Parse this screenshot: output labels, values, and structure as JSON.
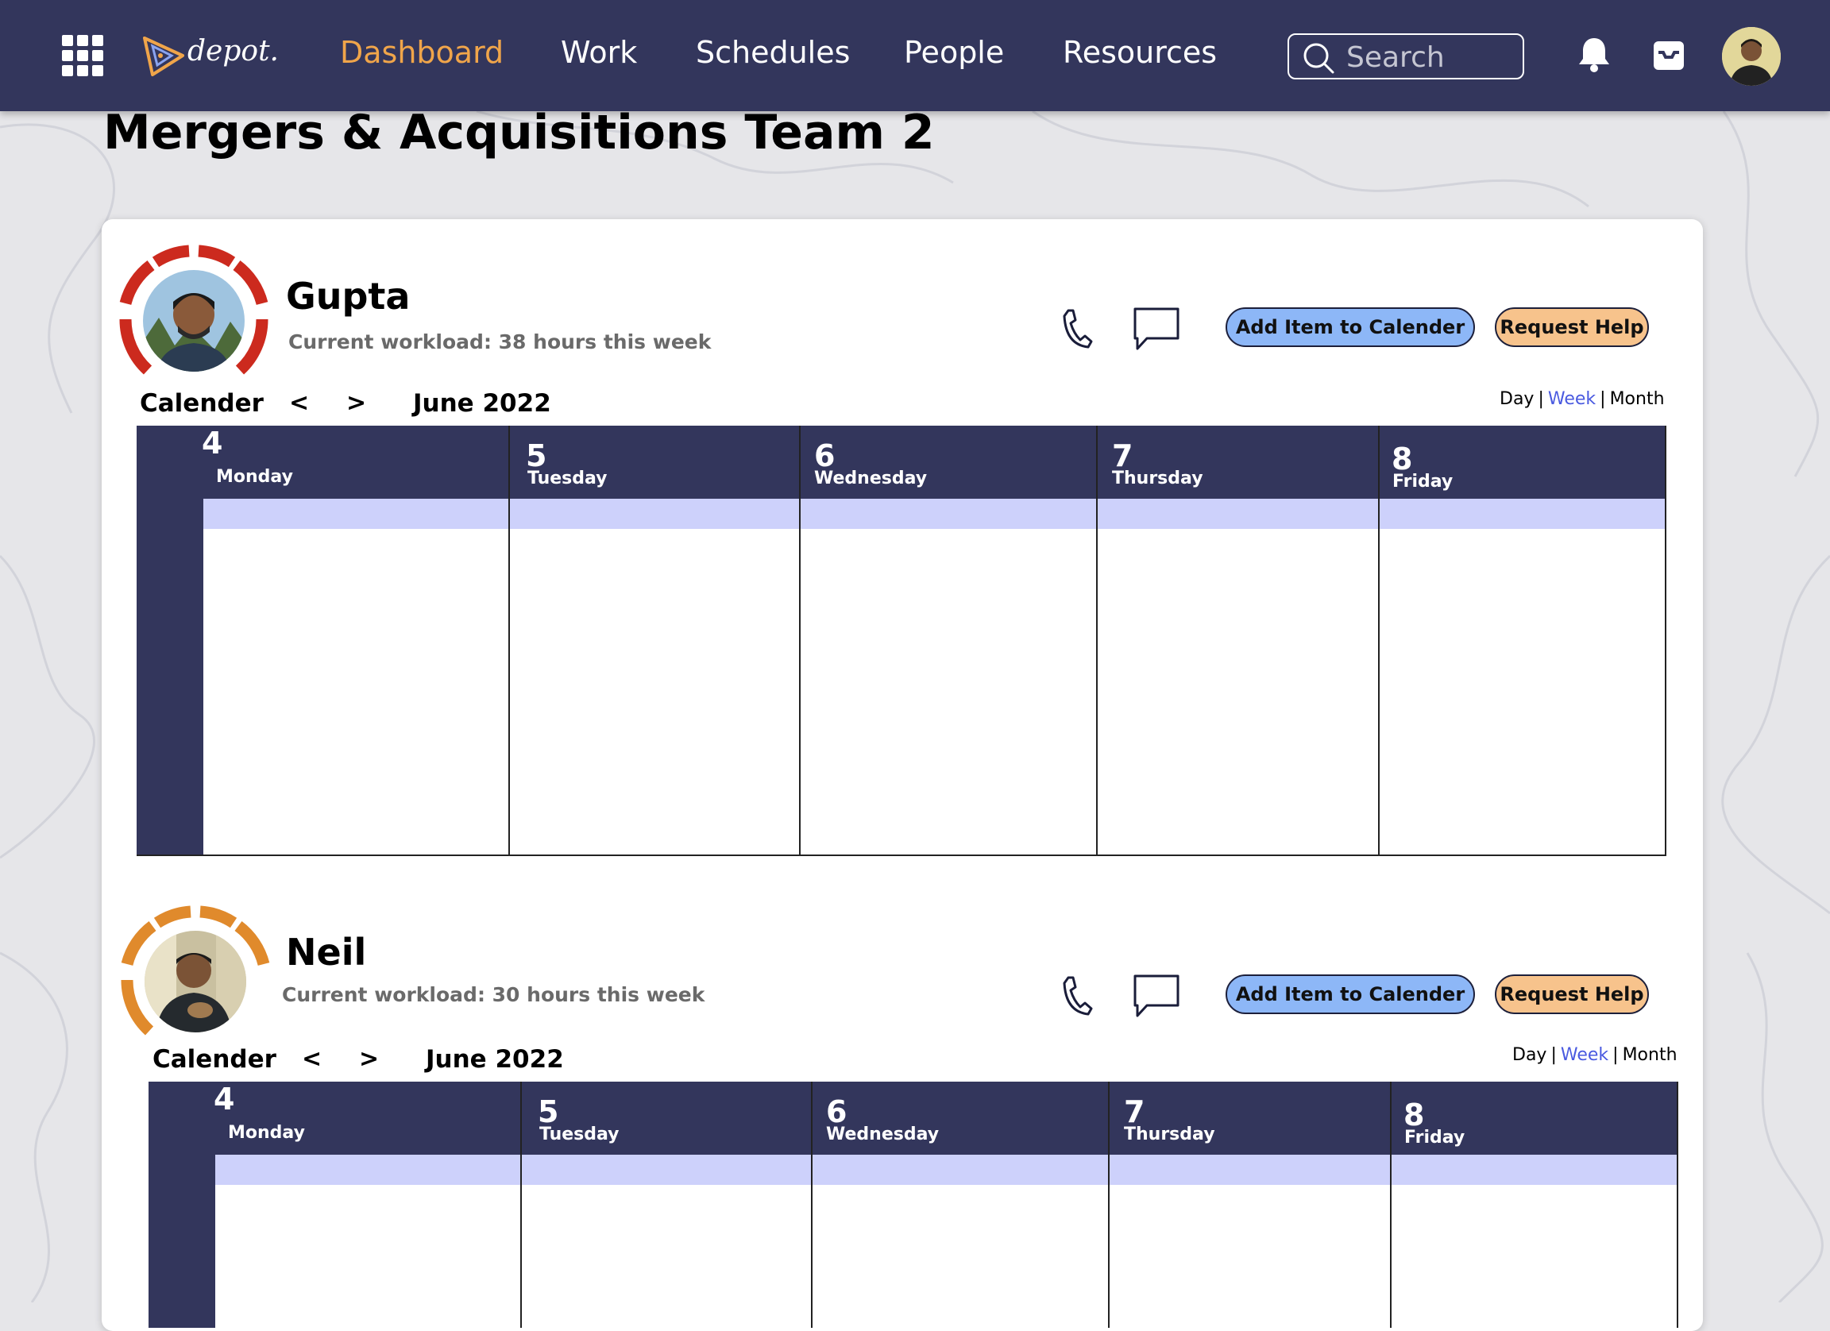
{
  "nav": {
    "logo_text": "depot.",
    "items": [
      {
        "label": "Dashboard",
        "active": true
      },
      {
        "label": "Work",
        "active": false
      },
      {
        "label": "Schedules",
        "active": false
      },
      {
        "label": "People",
        "active": false
      },
      {
        "label": "Resources",
        "active": false
      }
    ],
    "search_placeholder": "Search",
    "icons": [
      "apps-grid-icon",
      "bell-icon",
      "inbox-icon"
    ]
  },
  "page": {
    "title": "Mergers & Acquisitions Team 2"
  },
  "colors": {
    "navy": "#33365c",
    "accent_orange": "#f0a54a",
    "band_lavender": "#cdd1fb",
    "add_button": "#8db7f7",
    "help_button": "#f7c38c",
    "ring_gupta": "#cc2a1e",
    "ring_neil": "#e08a2c"
  },
  "members": [
    {
      "name": "Gupta",
      "workload": "Current workload: 38 hours this week",
      "add_label": "Add Item to Calender",
      "help_label": "Request Help",
      "calendar": {
        "label": "Calender",
        "prev": "<",
        "next": ">",
        "month": "June 2022",
        "views": [
          "Day",
          "Week",
          "Month"
        ],
        "active_view": "Week",
        "days": [
          {
            "num": "4",
            "name": "Monday"
          },
          {
            "num": "5",
            "name": "Tuesday"
          },
          {
            "num": "6",
            "name": "Wednesday"
          },
          {
            "num": "7",
            "name": "Thursday"
          },
          {
            "num": "8",
            "name": "Friday"
          }
        ]
      }
    },
    {
      "name": "Neil",
      "workload": "Current workload: 30 hours this week",
      "add_label": "Add Item to Calender",
      "help_label": "Request Help",
      "calendar": {
        "label": "Calender",
        "prev": "<",
        "next": ">",
        "month": "June 2022",
        "views": [
          "Day",
          "Week",
          "Month"
        ],
        "active_view": "Week",
        "days": [
          {
            "num": "4",
            "name": "Monday"
          },
          {
            "num": "5",
            "name": "Tuesday"
          },
          {
            "num": "6",
            "name": "Wednesday"
          },
          {
            "num": "7",
            "name": "Thursday"
          },
          {
            "num": "8",
            "name": "Friday"
          }
        ]
      }
    }
  ]
}
